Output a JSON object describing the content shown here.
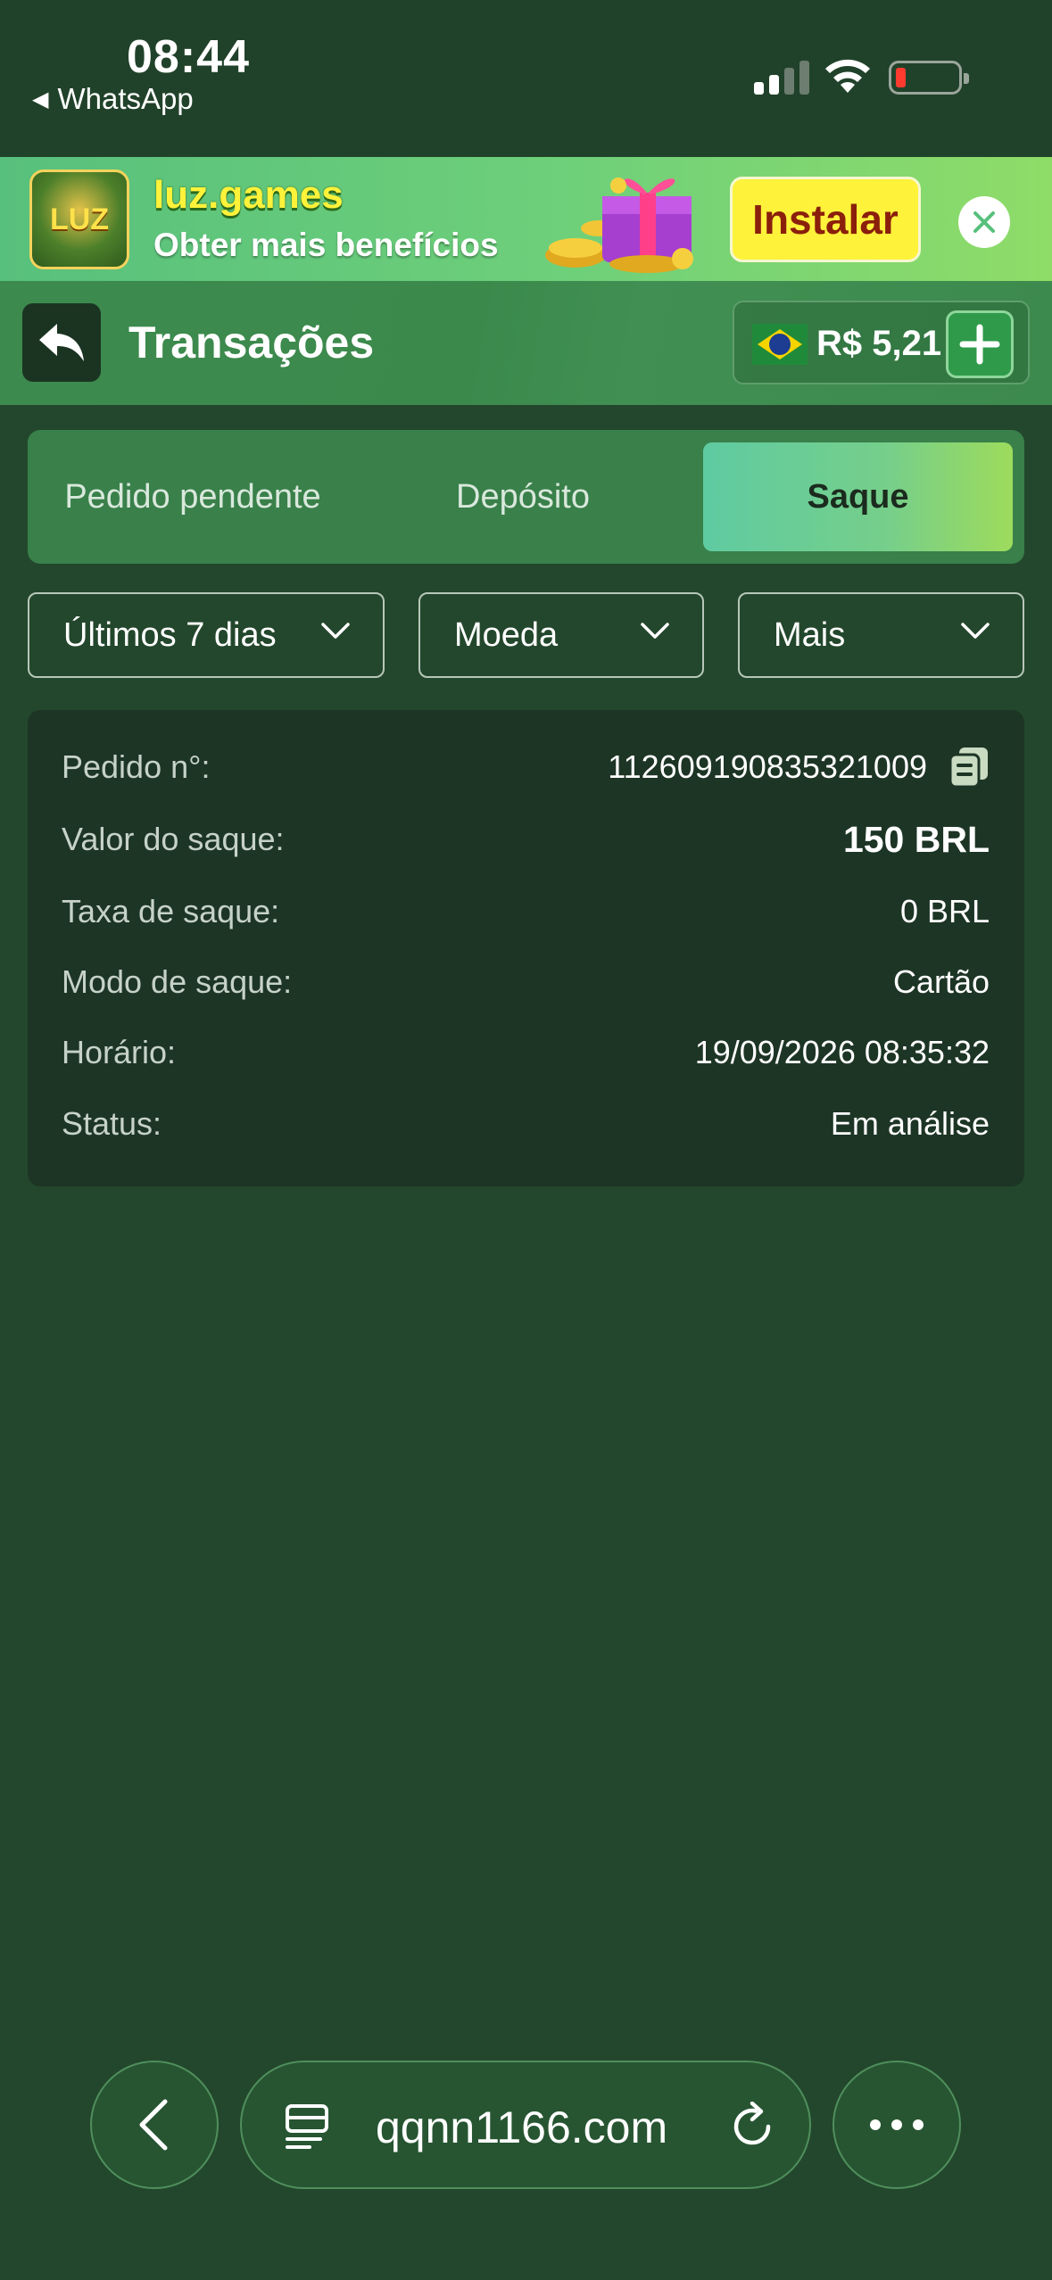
{
  "status_bar": {
    "time": "08:44",
    "back_app": "WhatsApp"
  },
  "banner": {
    "logo_text": "LUZ",
    "title": "luz.games",
    "subtitle": "Obter mais benefícios",
    "install_label": "Instalar"
  },
  "header": {
    "title": "Transações",
    "balance": "R$ 5,21"
  },
  "tabs": [
    {
      "label": "Pedido pendente",
      "active": false
    },
    {
      "label": "Depósito",
      "active": false
    },
    {
      "label": "Saque",
      "active": true
    }
  ],
  "filters": {
    "period": "Últimos 7 dias",
    "currency": "Moeda",
    "more": "Mais"
  },
  "transaction": {
    "order_label": "Pedido n°:",
    "order_value": "112609190835321009",
    "amount_label": "Valor do saque:",
    "amount_value": "150 BRL",
    "fee_label": "Taxa de saque:",
    "fee_value": "0 BRL",
    "mode_label": "Modo de saque:",
    "mode_value": "Cartão",
    "time_label": "Horário:",
    "time_value": "19/09/2026 08:35:32",
    "status_label": "Status:",
    "status_value": "Em análise"
  },
  "browser": {
    "url": "qqnn1166.com"
  },
  "colors": {
    "background": "#23472c",
    "header": "#3d8a4e",
    "card": "#1d3525",
    "accent_start": "#5fcba1",
    "accent_end": "#9ddb5c",
    "install_button": "#fff23a"
  }
}
